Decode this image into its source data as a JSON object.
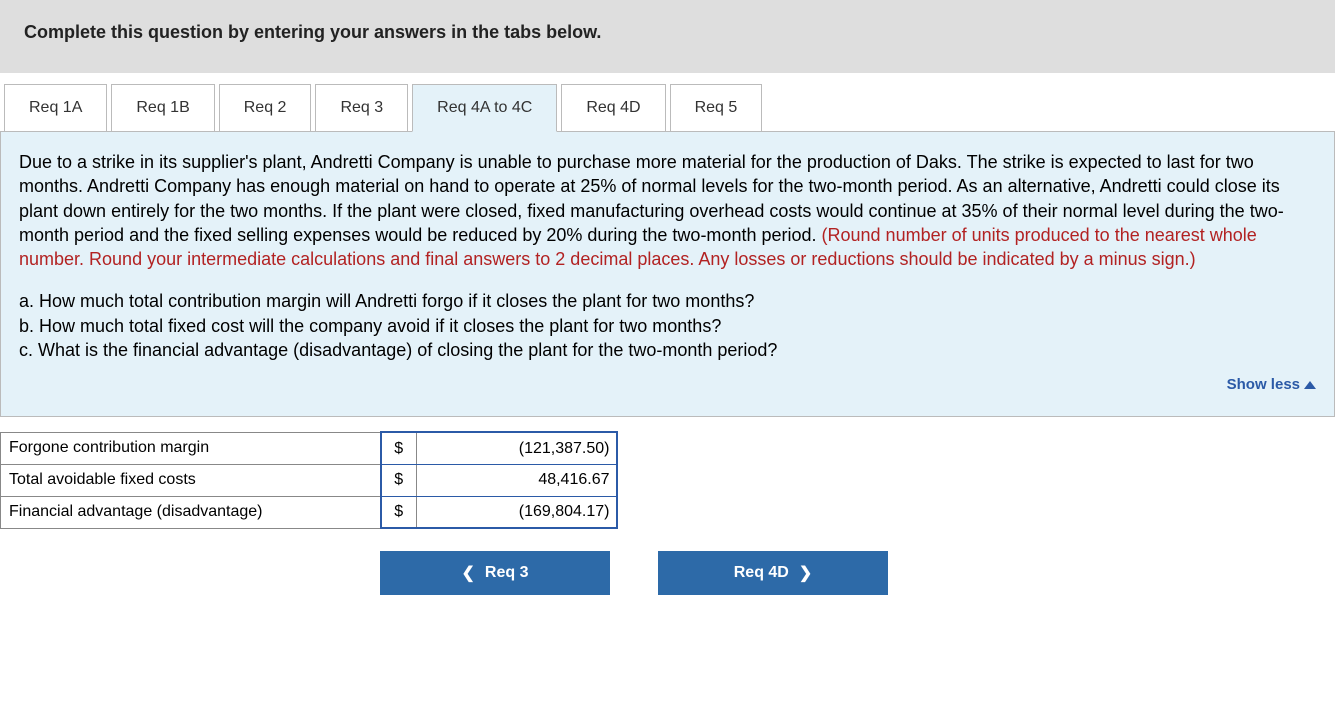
{
  "header": {
    "instruction": "Complete this question by entering your answers in the tabs below."
  },
  "tabs": [
    {
      "label": "Req 1A",
      "active": false
    },
    {
      "label": "Req 1B",
      "active": false
    },
    {
      "label": "Req 2",
      "active": false
    },
    {
      "label": "Req 3",
      "active": false
    },
    {
      "label": "Req 4A to 4C",
      "active": true
    },
    {
      "label": "Req 4D",
      "active": false
    },
    {
      "label": "Req 5",
      "active": false
    }
  ],
  "prompt": {
    "body": "Due to a strike in its supplier's plant, Andretti Company is unable to purchase more material for the production of Daks. The strike is expected to last for two months. Andretti Company has enough material on hand to operate at 25% of normal levels for the two-month period. As an alternative, Andretti could close its plant down entirely for the two months. If the plant were closed, fixed manufacturing overhead costs would continue at 35% of their normal level during the two-month period and the fixed selling expenses would be reduced by 20% during the two-month period. ",
    "hint": "(Round number of units produced to the nearest whole number. Round your intermediate calculations and final answers to 2 decimal places. Any losses or reductions should be indicated by a minus sign.)",
    "questions": {
      "a": "a. How much total contribution margin will Andretti forgo if it closes the plant for two months?",
      "b": "b. How much total fixed cost will the company avoid if it closes the plant for two months?",
      "c": "c. What is the financial advantage (disadvantage) of closing the plant for the two-month period?"
    }
  },
  "toggle": {
    "label": "Show less"
  },
  "answers": {
    "rows": [
      {
        "label": "Forgone contribution margin",
        "symbol": "$",
        "value": "(121,387.50)"
      },
      {
        "label": "Total avoidable fixed costs",
        "symbol": "$",
        "value": "48,416.67"
      },
      {
        "label": "Financial advantage (disadvantage)",
        "symbol": "$",
        "value": "(169,804.17)"
      }
    ]
  },
  "nav": {
    "prev": "Req 3",
    "next": "Req 4D"
  }
}
